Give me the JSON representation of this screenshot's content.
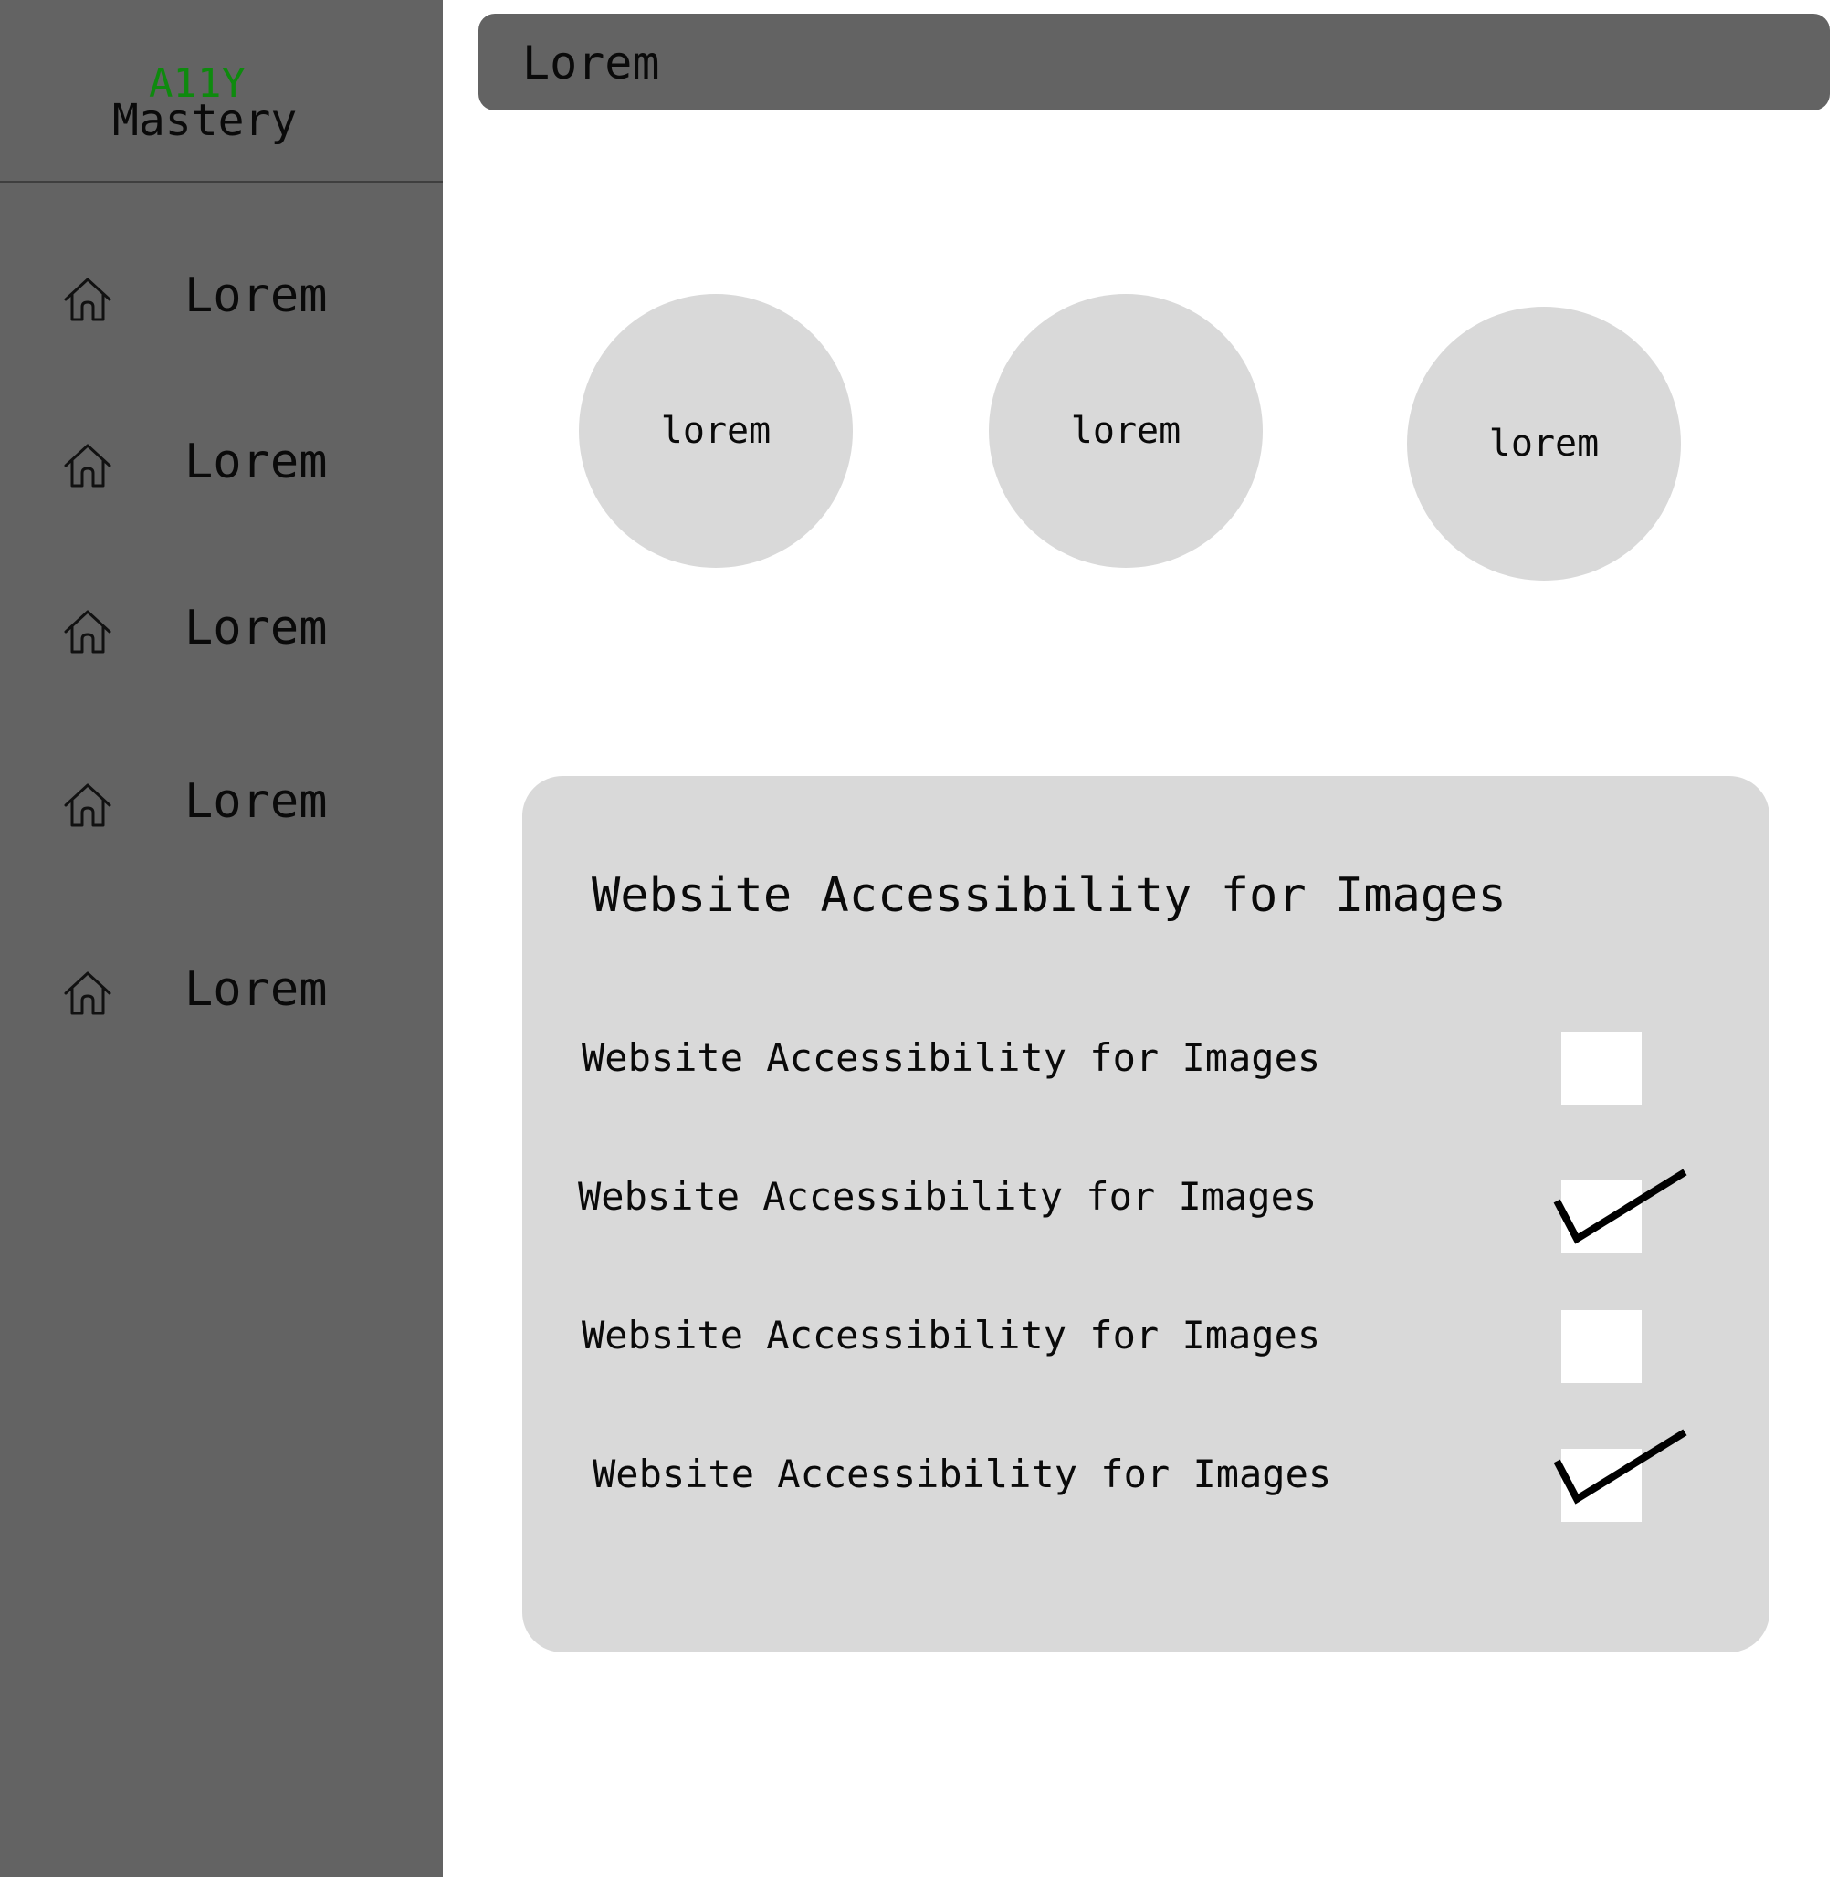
{
  "brand": {
    "accent": "A11Y",
    "name": "Mastery"
  },
  "sidebar": {
    "items": [
      {
        "icon": "home-icon",
        "label": "Lorem"
      },
      {
        "icon": "home-icon",
        "label": "Lorem"
      },
      {
        "icon": "home-icon",
        "label": "Lorem"
      },
      {
        "icon": "home-icon",
        "label": "Lorem"
      },
      {
        "icon": "home-icon",
        "label": "Lorem"
      }
    ]
  },
  "header": {
    "title": "Lorem"
  },
  "circles": [
    {
      "label": "lorem"
    },
    {
      "label": "lorem"
    },
    {
      "label": "lorem"
    }
  ],
  "card": {
    "title": "Website Accessibility for Images",
    "items": [
      {
        "label": "Website Accessibility for Images",
        "checked": false
      },
      {
        "label": "Website Accessibility for Images",
        "checked": true
      },
      {
        "label": "Website Accessibility for Images",
        "checked": false
      },
      {
        "label": "Website Accessibility for Images",
        "checked": true
      }
    ]
  },
  "colors": {
    "sidebar_bg": "#636363",
    "topbar_bg": "#636363",
    "card_bg": "#d9d9d9",
    "circle_bg": "#d9d9d9",
    "accent_green": "#0e8a0e",
    "page_bg": "#ffffff"
  }
}
